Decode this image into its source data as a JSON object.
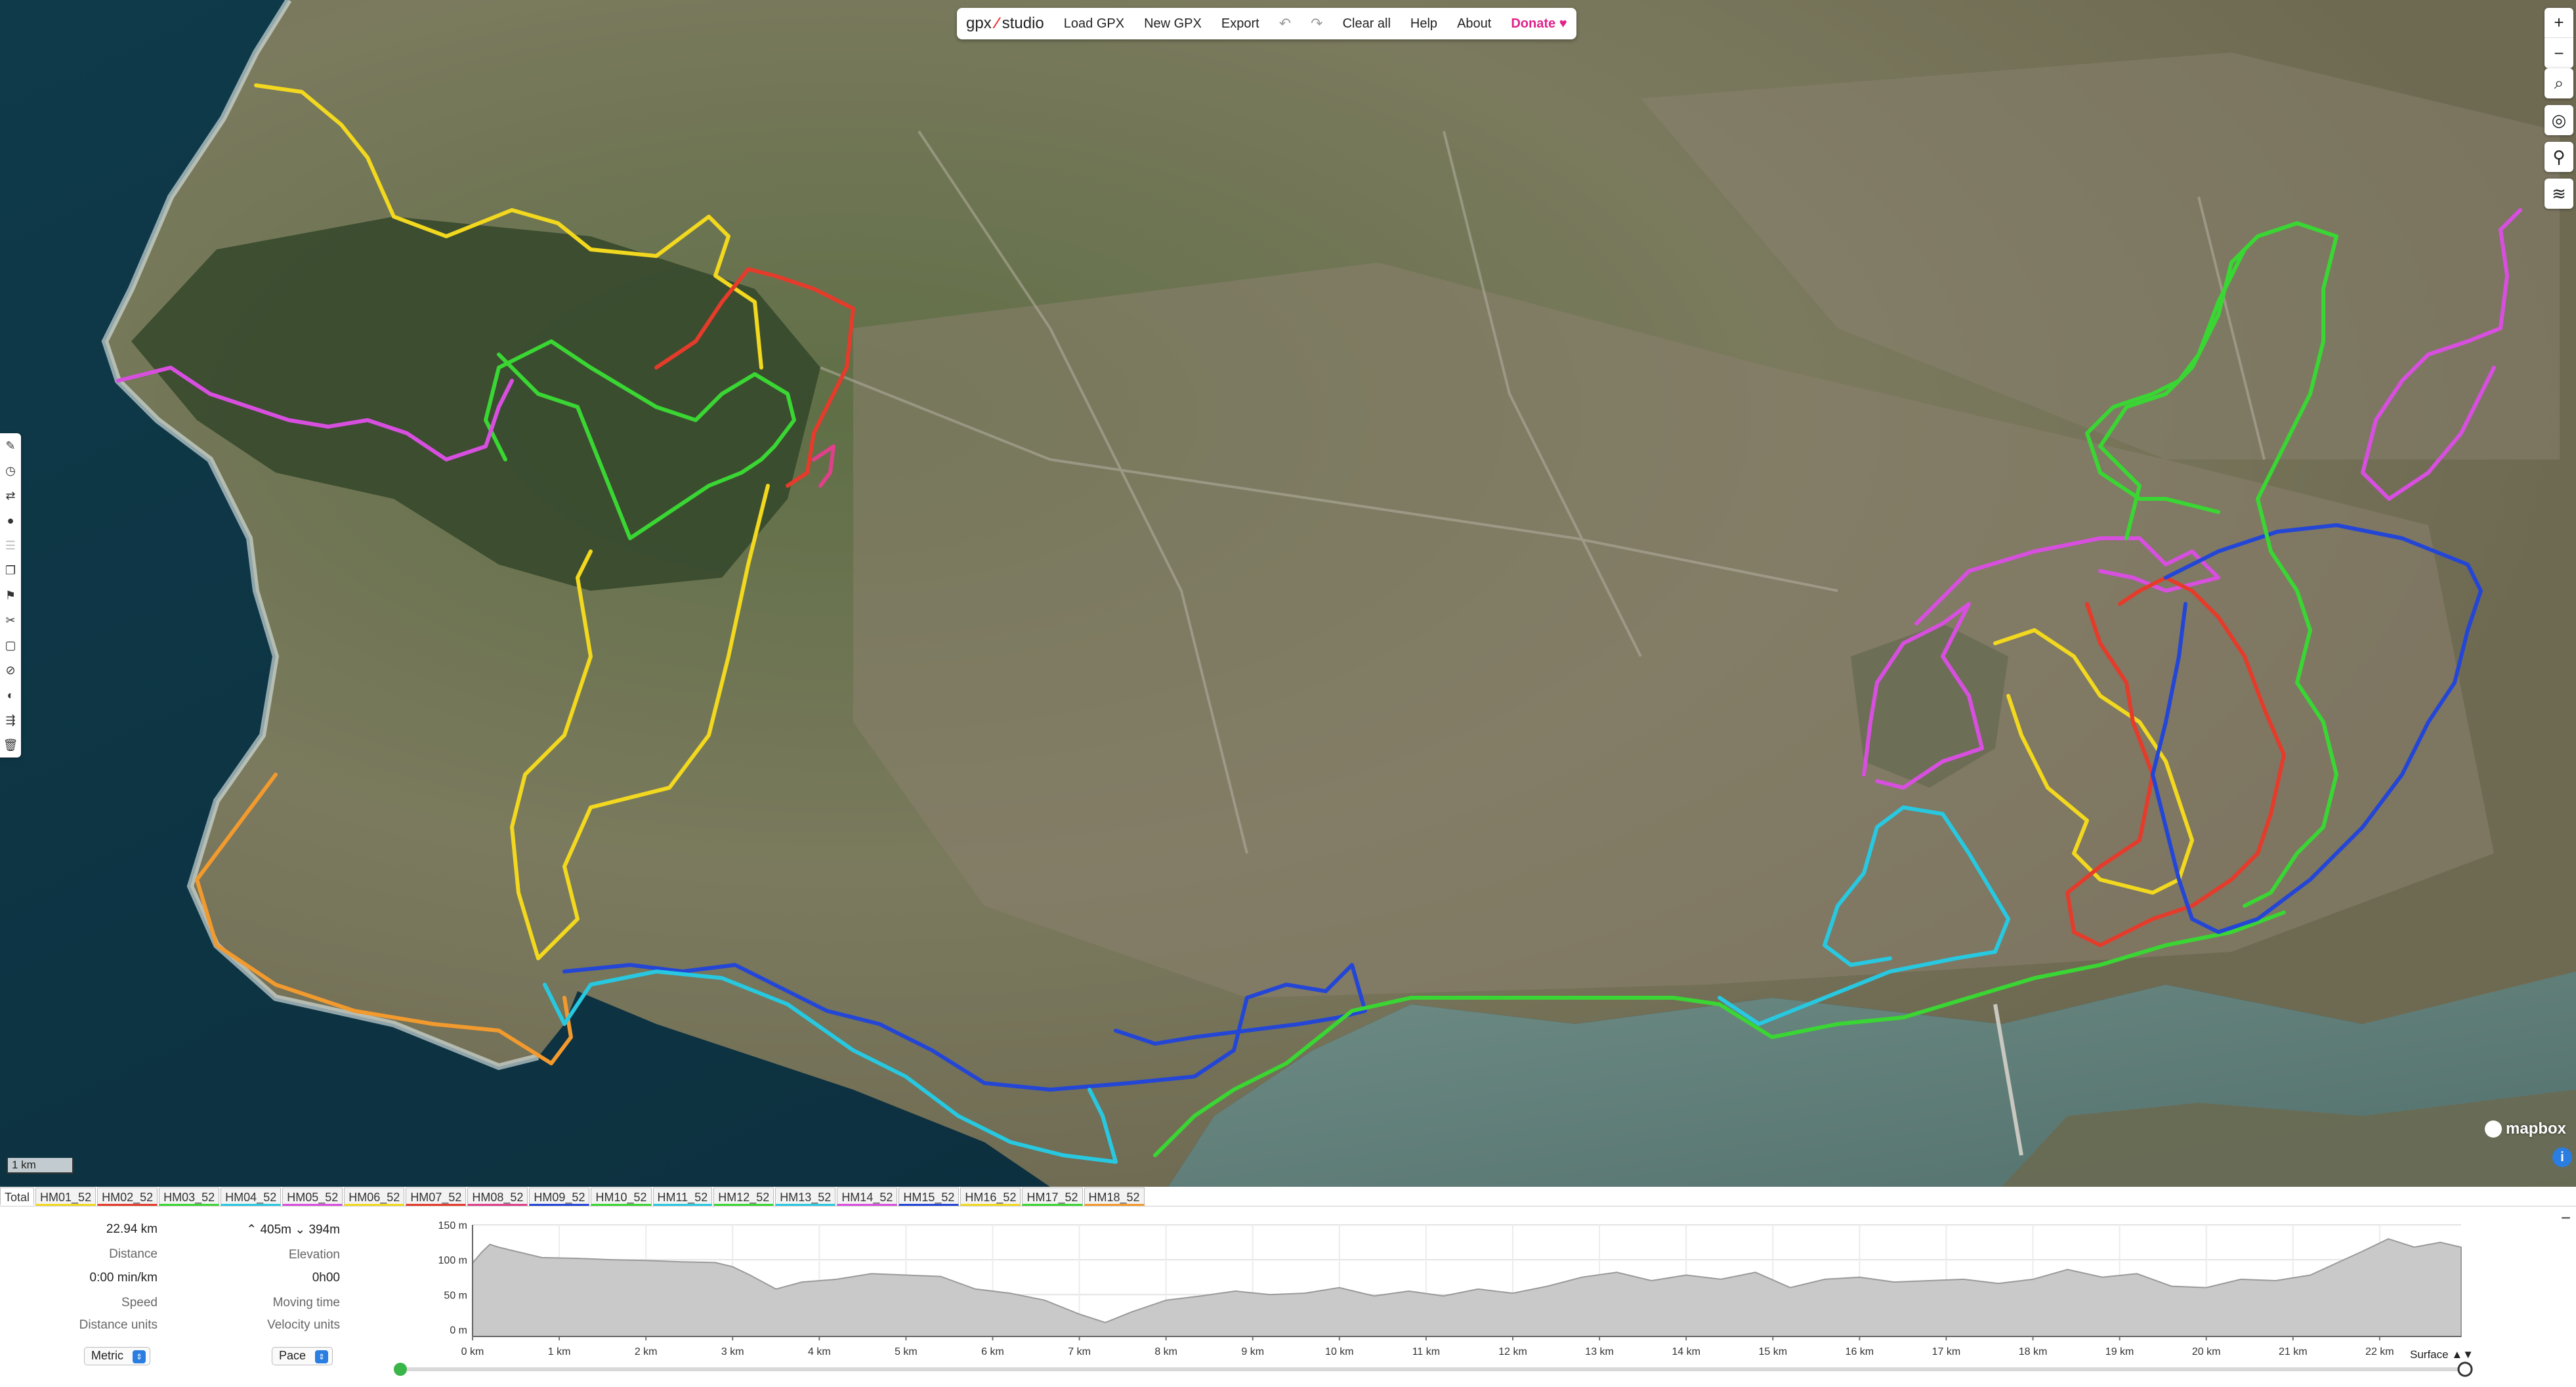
{
  "toolbar": {
    "brand_left": "gpx",
    "brand_right": "studio",
    "load": "Load GPX",
    "new": "New GPX",
    "export": "Export",
    "undo_icon": "undo-icon",
    "redo_icon": "redo-icon",
    "clear": "Clear all",
    "help": "Help",
    "about": "About",
    "donate": "Donate"
  },
  "map": {
    "scale": "1 km",
    "attribution": "mapbox"
  },
  "tabs": [
    {
      "label": "Total",
      "color": ""
    },
    {
      "label": "HM01_52",
      "color": "#f2d81e"
    },
    {
      "label": "HM02_52",
      "color": "#e53b2b"
    },
    {
      "label": "HM03_52",
      "color": "#3ad633"
    },
    {
      "label": "HM04_52",
      "color": "#28c8e0"
    },
    {
      "label": "HM05_52",
      "color": "#d84fe0"
    },
    {
      "label": "HM06_52",
      "color": "#f2d81e"
    },
    {
      "label": "HM07_52",
      "color": "#e53b2b"
    },
    {
      "label": "HM08_52",
      "color": "#e0408a"
    },
    {
      "label": "HM09_52",
      "color": "#2446d6"
    },
    {
      "label": "HM10_52",
      "color": "#3ad633"
    },
    {
      "label": "HM11_52",
      "color": "#28c8e0"
    },
    {
      "label": "HM12_52",
      "color": "#3ad633"
    },
    {
      "label": "HM13_52",
      "color": "#28c8e0"
    },
    {
      "label": "HM14_52",
      "color": "#d84fe0"
    },
    {
      "label": "HM15_52",
      "color": "#2446d6"
    },
    {
      "label": "HM16_52",
      "color": "#f2d81e"
    },
    {
      "label": "HM17_52",
      "color": "#3ad633"
    },
    {
      "label": "HM18_52",
      "color": "#f29a2e"
    }
  ],
  "stats": {
    "distance_value": "22.94 km",
    "distance_label": "Distance",
    "elevation_up": "405m",
    "elevation_down": "394m",
    "elevation_label": "Elevation",
    "speed_value": "0:00 min/km",
    "speed_label": "Speed",
    "moving_value": "0h00",
    "moving_label": "Moving time",
    "distance_units_label": "Distance units",
    "velocity_units_label": "Velocity units",
    "distance_units_value": "Metric",
    "velocity_units_value": "Pace"
  },
  "chart_data": {
    "type": "area",
    "title": "",
    "xlabel": "",
    "ylabel": "",
    "x_tick_labels": [
      "0 km",
      "1 km",
      "2 km",
      "3 km",
      "4 km",
      "5 km",
      "6 km",
      "7 km",
      "8 km",
      "9 km",
      "10 km",
      "11 km",
      "12 km",
      "13 km",
      "14 km",
      "15 km",
      "16 km",
      "17 km",
      "18 km",
      "19 km",
      "20 km",
      "21 km",
      "22 km"
    ],
    "y_tick_labels": [
      "150 m",
      "100 m",
      "50 m",
      "0 m"
    ],
    "xlim": [
      0,
      22.94
    ],
    "ylim": [
      -10,
      150
    ],
    "x": [
      0,
      0.1,
      0.2,
      0.3,
      0.5,
      0.8,
      1.2,
      1.6,
      2.0,
      2.4,
      2.8,
      3.0,
      3.2,
      3.5,
      3.8,
      4.2,
      4.6,
      5.0,
      5.4,
      5.8,
      6.2,
      6.6,
      7.0,
      7.3,
      7.6,
      8.0,
      8.4,
      8.8,
      9.2,
      9.6,
      10.0,
      10.4,
      10.8,
      11.2,
      11.6,
      12.0,
      12.4,
      12.8,
      13.2,
      13.6,
      14.0,
      14.4,
      14.8,
      15.2,
      15.6,
      16.0,
      16.4,
      16.8,
      17.2,
      17.6,
      18.0,
      18.4,
      18.8,
      19.2,
      19.6,
      20.0,
      20.4,
      20.8,
      21.2,
      21.5,
      21.8,
      22.1,
      22.4,
      22.7,
      22.94
    ],
    "elevation": [
      95,
      110,
      122,
      118,
      112,
      103,
      102,
      100,
      99,
      97,
      96,
      90,
      78,
      58,
      68,
      72,
      80,
      78,
      76,
      58,
      52,
      42,
      22,
      10,
      25,
      42,
      48,
      55,
      50,
      52,
      60,
      48,
      55,
      48,
      58,
      52,
      62,
      75,
      82,
      70,
      78,
      72,
      82,
      60,
      72,
      75,
      68,
      70,
      72,
      66,
      72,
      86,
      75,
      80,
      62,
      60,
      72,
      70,
      78,
      95,
      112,
      130,
      118,
      125,
      118
    ]
  },
  "surface_label": "Surface",
  "colors": {
    "yellow": "#f2d81e",
    "red": "#e53b2b",
    "green": "#3ad633",
    "cyan": "#28c8e0",
    "magenta": "#d84fe0",
    "blue": "#2446d6",
    "orange": "#f29a2e",
    "accent": "#e0218a"
  }
}
